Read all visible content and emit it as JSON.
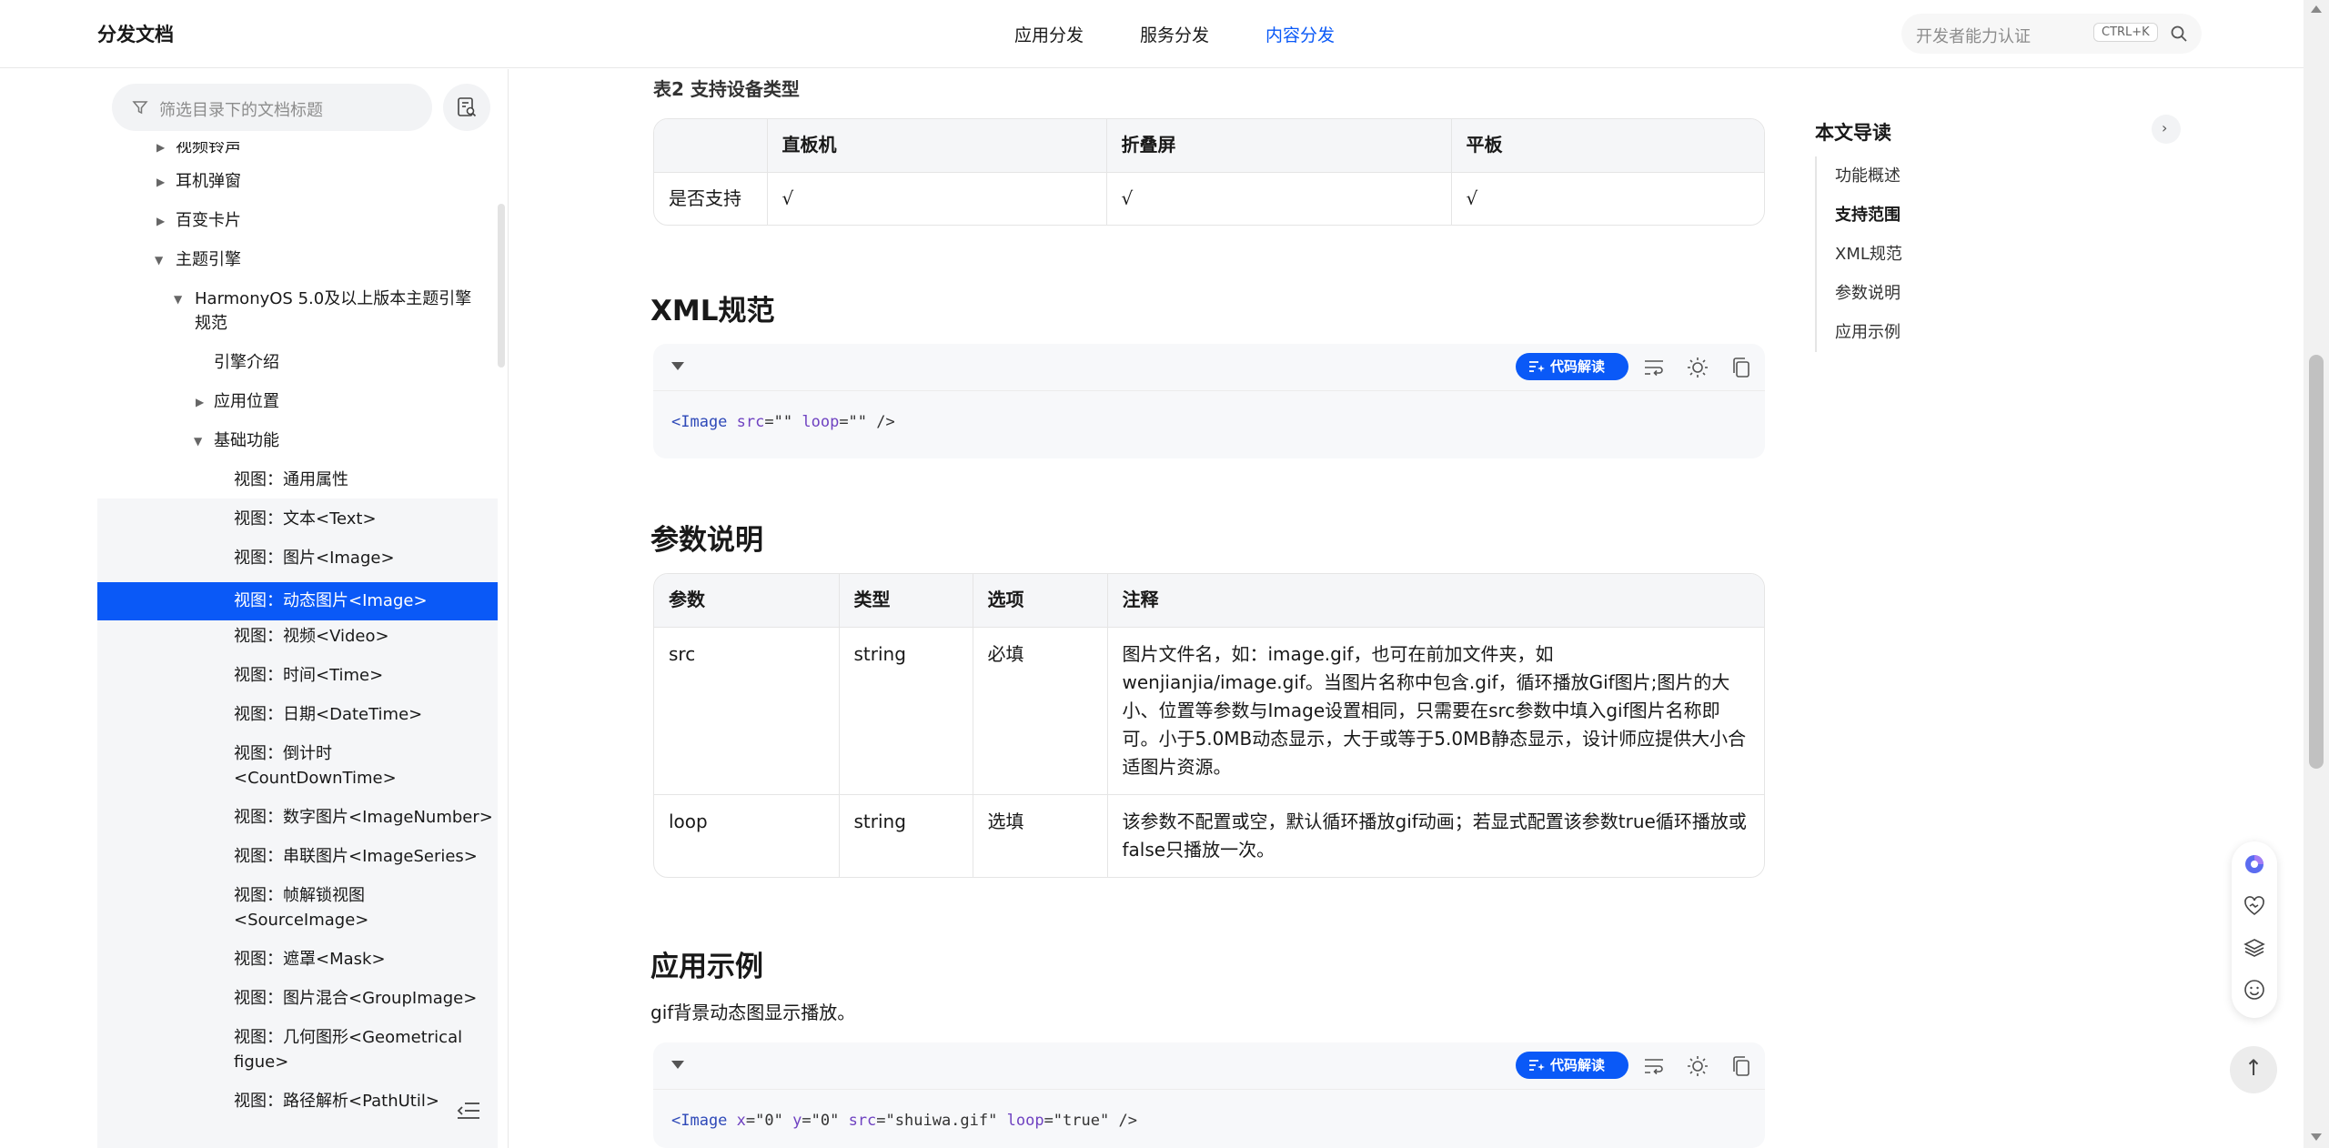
{
  "header": {
    "brand": "分发文档",
    "nav": [
      "应用分发",
      "服务分发",
      "内容分发"
    ],
    "nav_active": "内容分发",
    "search_placeholder": "开发者能力认证",
    "shortcut": "CTRL+K"
  },
  "sidebar": {
    "filter_placeholder": "筛选目录下的文档标题",
    "items": [
      "视频铃声",
      "耳机弹窗",
      "百变卡片",
      "主题引擎",
      "HarmonyOS 5.0及以上版本主题引擎",
      "规范",
      "引擎介绍",
      "应用位置",
      "基础功能",
      "视图：通用属性",
      "视图：文本<Text>",
      "视图：图片<Image>",
      "视图：动态图片<Image>",
      "视图：视频<Video>",
      "视图：时间<Time>",
      "视图：日期<DateTime>",
      "视图：倒计时",
      "<CountDownTime>",
      "视图：数字图片<ImageNumber>",
      "视图：串联图片<ImageSeries>",
      "视图：帧解锁视图",
      "<SourceImage>",
      "视图：遮罩<Mask>",
      "视图：图片混合<GroupImage>",
      "视图：几何图形<Geometrical",
      "figue>",
      "视图：路径解析<PathUtil>"
    ],
    "selected": "视图：动态图片<Image>"
  },
  "main": {
    "table1_caption": "表2 支持设备类型",
    "table1": {
      "headers": [
        "",
        "直板机",
        "折叠屏",
        "平板"
      ],
      "rows": [
        [
          "是否支持",
          "√",
          "√",
          "√"
        ]
      ]
    },
    "xml_heading": "XML规范",
    "code_ai_label": "代码解读",
    "code1": {
      "tag": "<Image",
      "attr1": "src",
      "val1": "=\"\"",
      "attr2": "loop",
      "val2": "=\"\"",
      "close": "/>"
    },
    "param_heading": "参数说明",
    "table2": {
      "headers": [
        "参数",
        "类型",
        "选项",
        "注释"
      ],
      "rows": [
        [
          "src",
          "string",
          "必填",
          "图片文件名，如：image.gif，也可在前加文件夹，如wenjianjia/image.gif。当图片名称中包含.gif，循环播放Gif图片;图片的大小、位置等参数与Image设置相同，只需要在src参数中填入gif图片名称即可。小于5.0MB动态显示，大于或等于5.0MB静态显示，设计师应提供大小合适图片资源。"
        ],
        [
          "loop",
          "string",
          "选填",
          "该参数不配置或空，默认循环播放gif动画；若显式配置该参数true循环播放或false只播放一次。"
        ]
      ]
    },
    "example_heading": "应用示例",
    "example_text": "gif背景动态图显示播放。",
    "code2": {
      "tag": "<Image",
      "a1": "x",
      "v1": "=\"0\"",
      "a2": "y",
      "v2": "=\"0\"",
      "a3": "src",
      "v3": "=\"shuiwa.gif\"",
      "a4": "loop",
      "v4": "=\"true\"",
      "close": "/>"
    }
  },
  "toc": {
    "title": "本文导读",
    "items": [
      "功能概述",
      "支持范围",
      "XML规范",
      "参数说明",
      "应用示例"
    ],
    "active": "支持范围"
  },
  "colors": {
    "accent": "#0a59f7",
    "text": "#191919",
    "muted": "#8c8c8c"
  }
}
